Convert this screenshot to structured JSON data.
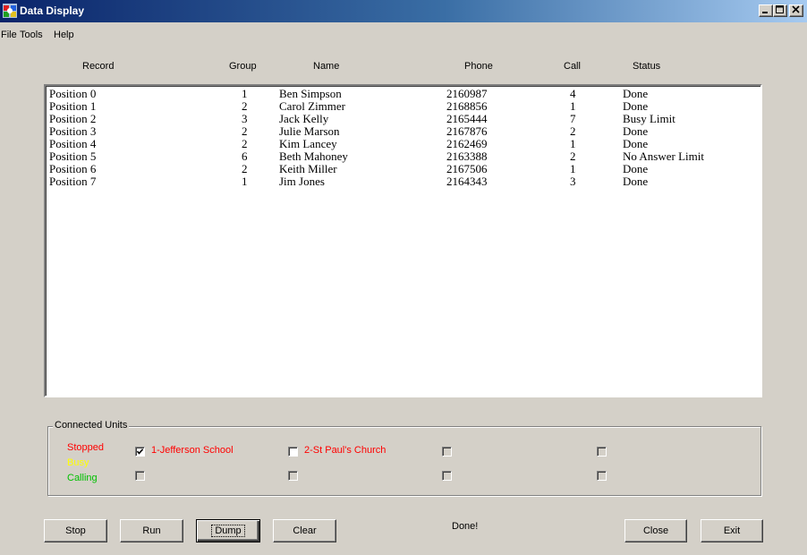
{
  "window": {
    "title": "Data Display",
    "controls": {
      "minimize": "_",
      "maximize": "□",
      "close": "×"
    }
  },
  "menu": [
    "File",
    "Tools",
    "Help"
  ],
  "columns": {
    "record": "Record",
    "group": "Group",
    "name": "Name",
    "phone": "Phone",
    "call": "Call",
    "status": "Status"
  },
  "rows": [
    {
      "record": "Position 0",
      "group": "1",
      "name": "Ben Simpson",
      "phone": "2160987",
      "call": "4",
      "status": "Done"
    },
    {
      "record": "Position 1",
      "group": "2",
      "name": "Carol Zimmer",
      "phone": "2168856",
      "call": "1",
      "status": "Done"
    },
    {
      "record": "Position 2",
      "group": "3",
      "name": "Jack Kelly",
      "phone": "2165444",
      "call": "7",
      "status": "Busy Limit"
    },
    {
      "record": "Position 3",
      "group": "2",
      "name": "Julie Marson",
      "phone": "2167876",
      "call": "2",
      "status": "Done"
    },
    {
      "record": "Position 4",
      "group": "2",
      "name": "Kim Lancey",
      "phone": "2162469",
      "call": "1",
      "status": "Done"
    },
    {
      "record": "Position 5",
      "group": "6",
      "name": "Beth Mahoney",
      "phone": "2163388",
      "call": "2",
      "status": "No Answer Limit"
    },
    {
      "record": "Position 6",
      "group": "2",
      "name": "Keith Miller",
      "phone": "2167506",
      "call": "1",
      "status": "Done"
    },
    {
      "record": "Position 7",
      "group": "1",
      "name": "Jim Jones",
      "phone": "2164343",
      "call": "3",
      "status": "Done"
    }
  ],
  "units": {
    "title": "Connected Units",
    "legend": [
      {
        "label": "Stopped",
        "color": "#ff0000"
      },
      {
        "label": "Busy",
        "color": "#ffff00"
      },
      {
        "label": "Calling",
        "color": "#00c000"
      }
    ],
    "checkboxes": [
      {
        "label": "1-Jefferson School",
        "checked": true,
        "enabled": true
      },
      {
        "label": "2-St Paul's Church",
        "checked": false,
        "enabled": true
      },
      {
        "label": "",
        "checked": false,
        "enabled": false
      },
      {
        "label": "",
        "checked": false,
        "enabled": false
      },
      {
        "label": "",
        "checked": false,
        "enabled": false
      },
      {
        "label": "",
        "checked": false,
        "enabled": false
      },
      {
        "label": "",
        "checked": false,
        "enabled": false
      },
      {
        "label": "",
        "checked": false,
        "enabled": false
      }
    ]
  },
  "buttons": {
    "stop": "Stop",
    "run": "Run",
    "dump": "Dump",
    "clear": "Clear",
    "close": "Close",
    "exit": "Exit"
  },
  "status": "Done!"
}
